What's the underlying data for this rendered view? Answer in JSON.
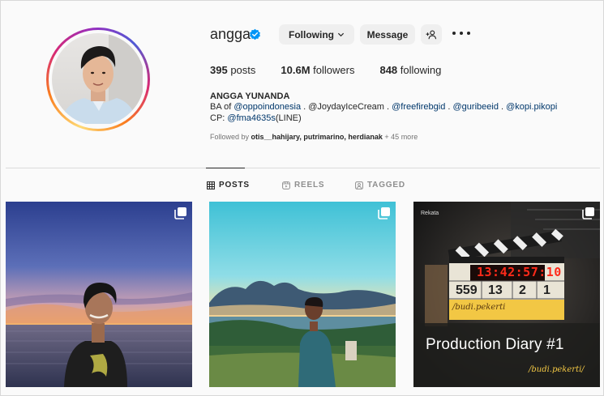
{
  "profile": {
    "username": "angga",
    "verified": true,
    "following_label": "Following",
    "message_label": "Message",
    "stats": {
      "posts_count": "395",
      "posts_label": "posts",
      "followers_count": "10.6M",
      "followers_label": "followers",
      "following_count": "848",
      "following_label": "following"
    },
    "full_name": "ANGGA YUNANDA",
    "bio": {
      "line1_prefix": "BA of ",
      "mention1": "@oppoindonesia",
      "sep1": " . ",
      "mention2": "@JoydayIceCream",
      "sep2": " . ",
      "mention3": "@freefirebgid",
      "sep3": " . ",
      "mention4": "@guribeeid",
      "sep4": " . ",
      "mention5": "@kopi.pikopi",
      "line2_prefix": "CP: ",
      "mention6": "@fma4635s",
      "line2_suffix": "(LINE)"
    },
    "followed_by": {
      "prefix": "Followed by ",
      "names": "otis__hahijary, putrimarino, herdianak",
      "suffix": " + 45 more"
    }
  },
  "tabs": [
    {
      "label": "POSTS",
      "icon": "grid-icon",
      "active": true
    },
    {
      "label": "REELS",
      "icon": "reels-icon",
      "active": false
    },
    {
      "label": "TAGGED",
      "icon": "tagged-icon",
      "active": false
    }
  ],
  "posts": [
    {
      "kind": "carousel",
      "icon": "multiple-posts-icon"
    },
    {
      "kind": "carousel",
      "icon": "multiple-posts-icon"
    },
    {
      "kind": "carousel",
      "icon": "multiple-posts-icon",
      "brand": "Rekata",
      "title": "Production Diary #1",
      "handle": "/budi.pekerti/",
      "clapper_time": "13:42:57:10",
      "clapper_numbers": [
        "559",
        "13",
        "2",
        "1"
      ],
      "clapper_handle": "/budi.pekerti"
    }
  ],
  "colors": {
    "link": "#00376b",
    "verified": "#0095f6",
    "button_bg": "#efefef"
  }
}
